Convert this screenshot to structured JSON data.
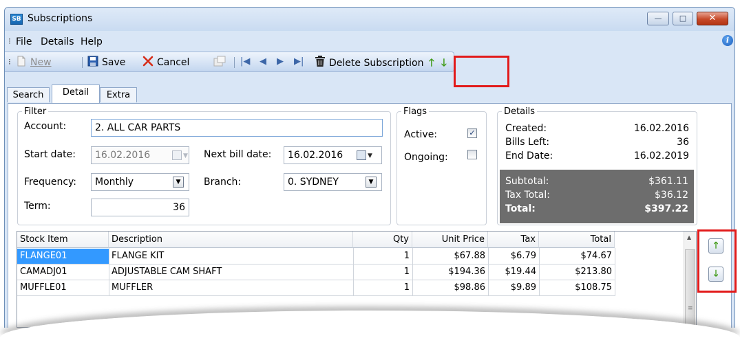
{
  "window": {
    "app_icon": "SB",
    "title": "Subscriptions",
    "controls": {
      "minimize": "—",
      "maximize": "□",
      "close": "✕"
    }
  },
  "menu": {
    "items": [
      "File",
      "Details",
      "Help"
    ],
    "info_icon": "i"
  },
  "toolbar": {
    "new_label": "New",
    "save_label": "Save",
    "cancel_label": "Cancel",
    "delete_label": "Delete Subscription",
    "nav_first": "|◀",
    "nav_prev": "◀",
    "nav_next": "▶",
    "nav_last": "▶|",
    "move_up": "🡑",
    "move_down": "🡓"
  },
  "tabs": [
    "Search",
    "Detail",
    "Extra"
  ],
  "filter": {
    "legend": "Filter",
    "account_label": "Account:",
    "account_value": "2. ALL CAR PARTS",
    "start_date_label": "Start date:",
    "start_date_value": "16.02.2016",
    "next_bill_label": "Next bill date:",
    "next_bill_value": "16.02.2016",
    "frequency_label": "Frequency:",
    "frequency_value": "Monthly",
    "branch_label": "Branch:",
    "branch_value": "0. SYDNEY",
    "term_label": "Term:",
    "term_value": "36"
  },
  "flags": {
    "legend": "Flags",
    "active_label": "Active:",
    "active_checked": true,
    "ongoing_label": "Ongoing:",
    "ongoing_checked": false,
    "check_mark": "✓"
  },
  "details": {
    "legend": "Details",
    "created_label": "Created:",
    "created_value": "16.02.2016",
    "bills_left_label": "Bills Left:",
    "bills_left_value": "36",
    "end_date_label": "End Date:",
    "end_date_value": "16.02.2019",
    "subtotal_label": "Subtotal:",
    "subtotal_value": "$361.11",
    "tax_label": "Tax Total:",
    "tax_value": "$36.12",
    "total_label": "Total:",
    "total_value": "$397.22"
  },
  "grid": {
    "columns": [
      "Stock Item",
      "Description",
      "Qty",
      "Unit Price",
      "Tax",
      "Total"
    ],
    "rows": [
      [
        "FLANGE01",
        "FLANGE KIT",
        "1",
        "$67.88",
        "$6.79",
        "$74.67"
      ],
      [
        "CAMADJ01",
        "ADJUSTABLE CAM SHAFT",
        "1",
        "$194.36",
        "$19.44",
        "$213.80"
      ],
      [
        "MUFFLE01",
        "MUFFLER",
        "1",
        "$98.86",
        "$9.89",
        "$108.75"
      ]
    ],
    "side_up": "🡑",
    "side_down": "🡓"
  },
  "colors": {
    "highlight": "#e21a1a",
    "window_bg": "#d9e6f6",
    "totals_bg": "#6d6d6d",
    "selected_cell": "#3399ff"
  }
}
